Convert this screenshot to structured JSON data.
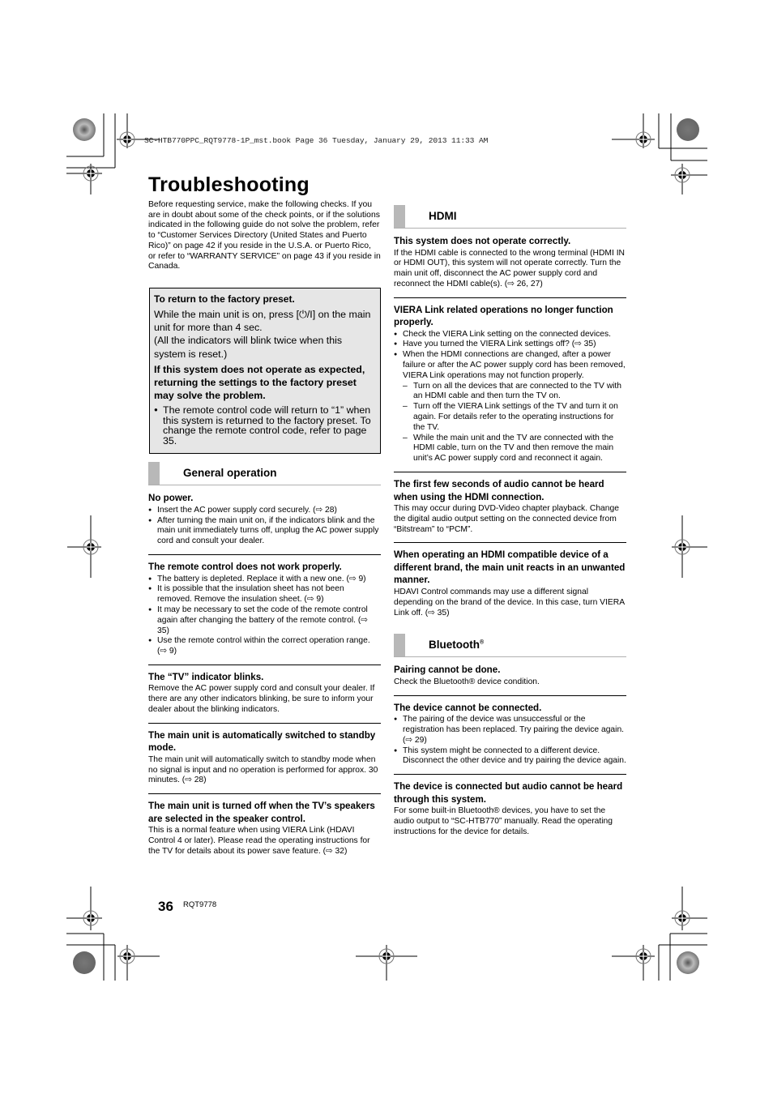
{
  "slug_line": "SC-HTB770PPC_RQT9778-1P_mst.book  Page 36  Tuesday, January 29, 2013  11:33 AM",
  "page_title": "Troubleshooting",
  "intro": "Before requesting service, make the following checks. If you are in doubt about some of the check points, or if the solutions indicated in the following guide do not solve the problem, refer to “Customer Services Directory (United States and Puerto Rico)” on page 42 if you reside in the U.S.A. or Puerto Rico, or refer to “WARRANTY SERVICE” on page 43 if you reside in Canada.",
  "preset_box": {
    "heading": "To return to the factory preset.",
    "text1": "While the main unit is on, press [⏻/I] on the main unit for more than 4 sec.",
    "text2": "(All the indicators will blink twice when this system is reset.)",
    "bold_text": "If this system does not operate as expected, returning the settings to the factory preset may solve the problem.",
    "bullet": "The remote control code will return to “1” when this system is returned to the factory preset. To change the remote control code, refer to page 35."
  },
  "sections": {
    "general": {
      "title": "General operation",
      "issues": [
        {
          "title": "No power.",
          "bullets": [
            "Insert the AC power supply cord securely. (⇨ 28)",
            "After turning the main unit on, if the indicators blink and the main unit immediately turns off, unplug the AC power supply cord and consult your dealer."
          ]
        },
        {
          "title": "The remote control does not work properly.",
          "bullets": [
            "The battery is depleted. Replace it with a new one. (⇨ 9)",
            "It is possible that the insulation sheet has not been removed. Remove the insulation sheet. (⇨ 9)",
            "It may be necessary to set the code of the remote control again after changing the battery of the remote control. (⇨ 35)",
            "Use the remote control within the correct operation range. (⇨ 9)"
          ]
        },
        {
          "title": "The “TV” indicator blinks.",
          "text": "Remove the AC power supply cord and consult your dealer. If there are any other indicators blinking, be sure to inform your dealer about the blinking indicators."
        },
        {
          "title": "The main unit is automatically switched to standby mode.",
          "text": "The main unit will automatically switch to standby mode when no signal is input and no operation is performed for approx. 30 minutes. (⇨ 28)"
        },
        {
          "title": "The main unit is turned off when the TV’s speakers are selected in the speaker control.",
          "text": "This is a normal feature when using VIERA Link (HDAVI Control 4 or later). Please read the operating instructions for the TV for details about its power save feature. (⇨ 32)"
        }
      ]
    },
    "hdmi": {
      "title": "HDMI",
      "issues": [
        {
          "title": "This system does not operate correctly.",
          "text": "If the HDMI cable is connected to the wrong terminal (HDMI IN or HDMI OUT), this system will not operate correctly. Turn the main unit off, disconnect the AC power supply cord and reconnect the HDMI cable(s). (⇨ 26, 27)"
        },
        {
          "title": "VIERA Link related operations no longer function properly.",
          "bullets": [
            "Check the VIERA Link setting on the connected devices.",
            "Have you turned the VIERA Link settings off? (⇨ 35)",
            "When the HDMI connections are changed, after a power failure or after the AC power supply cord has been removed, VIERA Link operations may not function properly."
          ],
          "dashes": [
            "Turn on all the devices that are connected to the TV with an HDMI cable and then turn the TV on.",
            "Turn off the VIERA Link settings of the TV and turn it on again. For details refer to the operating instructions for the TV.",
            "While the main unit and the TV are connected with the HDMI cable, turn on the TV and then remove the main unit’s AC power supply cord and reconnect it again."
          ]
        },
        {
          "title": "The first few seconds of audio cannot be heard when using the HDMI connection.",
          "text": "This may occur during DVD-Video chapter playback. Change the digital audio output setting on the connected device from “Bitstream” to “PCM”."
        },
        {
          "title": "When operating an HDMI compatible device of a different brand, the main unit reacts in an unwanted manner.",
          "text": "HDAVI Control commands may use a different signal depending on the brand of the device. In this case, turn VIERA Link off. (⇨ 35)"
        }
      ]
    },
    "bluetooth": {
      "title": "Bluetooth",
      "title_mark": "®",
      "issues": [
        {
          "title": "Pairing cannot be done.",
          "text": "Check the Bluetooth® device condition."
        },
        {
          "title": "The device cannot be connected.",
          "bullets": [
            "The pairing of the device was unsuccessful or the registration has been replaced. Try pairing the device again. (⇨ 29)",
            "This system might be connected to a different device. Disconnect the other device and try pairing the device again."
          ]
        },
        {
          "title": "The device is connected but audio cannot be heard through this system.",
          "text": "For some built-in Bluetooth® devices, you have to set the audio output to “SC-HTB770” manually. Read the operating instructions for the device for details."
        }
      ]
    }
  },
  "footer": {
    "page_number": "36",
    "model_code": "RQT9778"
  }
}
